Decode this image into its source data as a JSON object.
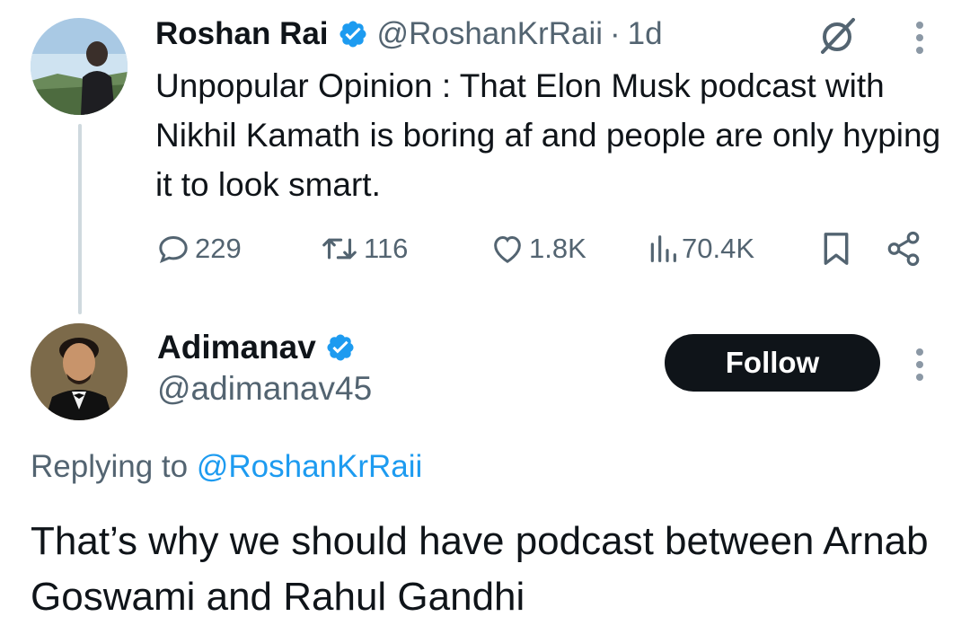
{
  "parent_tweet": {
    "author_name": "Roshan Rai",
    "handle": "@RoshanKrRaii",
    "separator": "·",
    "time": "1d",
    "text": "Unpopular Opinion : That Elon Musk podcast with Nikhil Kamath is boring af and people are only hyping it to look smart.",
    "actions": {
      "replies": "229",
      "reposts": "116",
      "likes": "1.8K",
      "views": "70.4K"
    },
    "icons": [
      "grok-icon",
      "more-icon",
      "reply-icon",
      "repost-icon",
      "like-icon",
      "views-icon",
      "bookmark-icon",
      "share-icon"
    ]
  },
  "reply_tweet": {
    "author_name": "Adimanav",
    "handle": "@adimanav45",
    "follow_label": "Follow",
    "replying_prefix": "Replying to ",
    "replying_mention": "@RoshanKrRaii",
    "text": "That’s why we should have podcast between Arnab Goswami and Rahul Gandhi"
  },
  "colors": {
    "verified": "#1d9bf0",
    "text_primary": "#0f1419",
    "text_secondary": "#536471",
    "link": "#1d9bf0",
    "follow_bg": "#0f1419"
  }
}
